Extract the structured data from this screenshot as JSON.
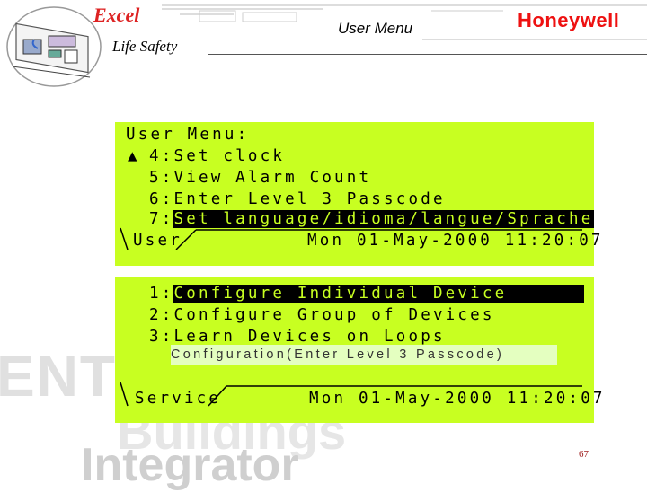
{
  "header": {
    "brand": "Excel",
    "brand_sub": "Life Safety",
    "title": "User Menu",
    "logo": "Honeywell"
  },
  "watermark": {
    "line1": "ENTER",
    "line2": "Buildings",
    "line3": "Integrator"
  },
  "user_menu": {
    "heading": "User Menu:",
    "scroll_marker": "▲",
    "items": [
      {
        "number": "4:",
        "label": "Set clock"
      },
      {
        "number": "5:",
        "label": "View Alarm Count"
      },
      {
        "number": "6:",
        "label": "Enter Level 3 Passcode"
      },
      {
        "number": "7:",
        "label": "Set language/idioma/langue/Sprache",
        "selected": true
      }
    ],
    "status_label": "User",
    "status_datetime": "Mon 01-May-2000 11:20:07"
  },
  "service_menu": {
    "items": [
      {
        "number": "1:",
        "label": "Configure Individual Device",
        "selected": true
      },
      {
        "number": "2:",
        "label": "Configure Group of Devices"
      },
      {
        "number": "3:",
        "label": "Learn Devices on Loops"
      }
    ],
    "dim_item": "Configuration(Enter Level 3 Passcode)",
    "status_label": "Service",
    "status_datetime": "Mon 01-May-2000 11:20:07"
  },
  "colors": {
    "lcd_background": "#c8ff21",
    "brand_red": "#dd2222"
  },
  "icons": {
    "product_image": "controller-board-icon"
  },
  "footer": {
    "page_number": "67"
  }
}
